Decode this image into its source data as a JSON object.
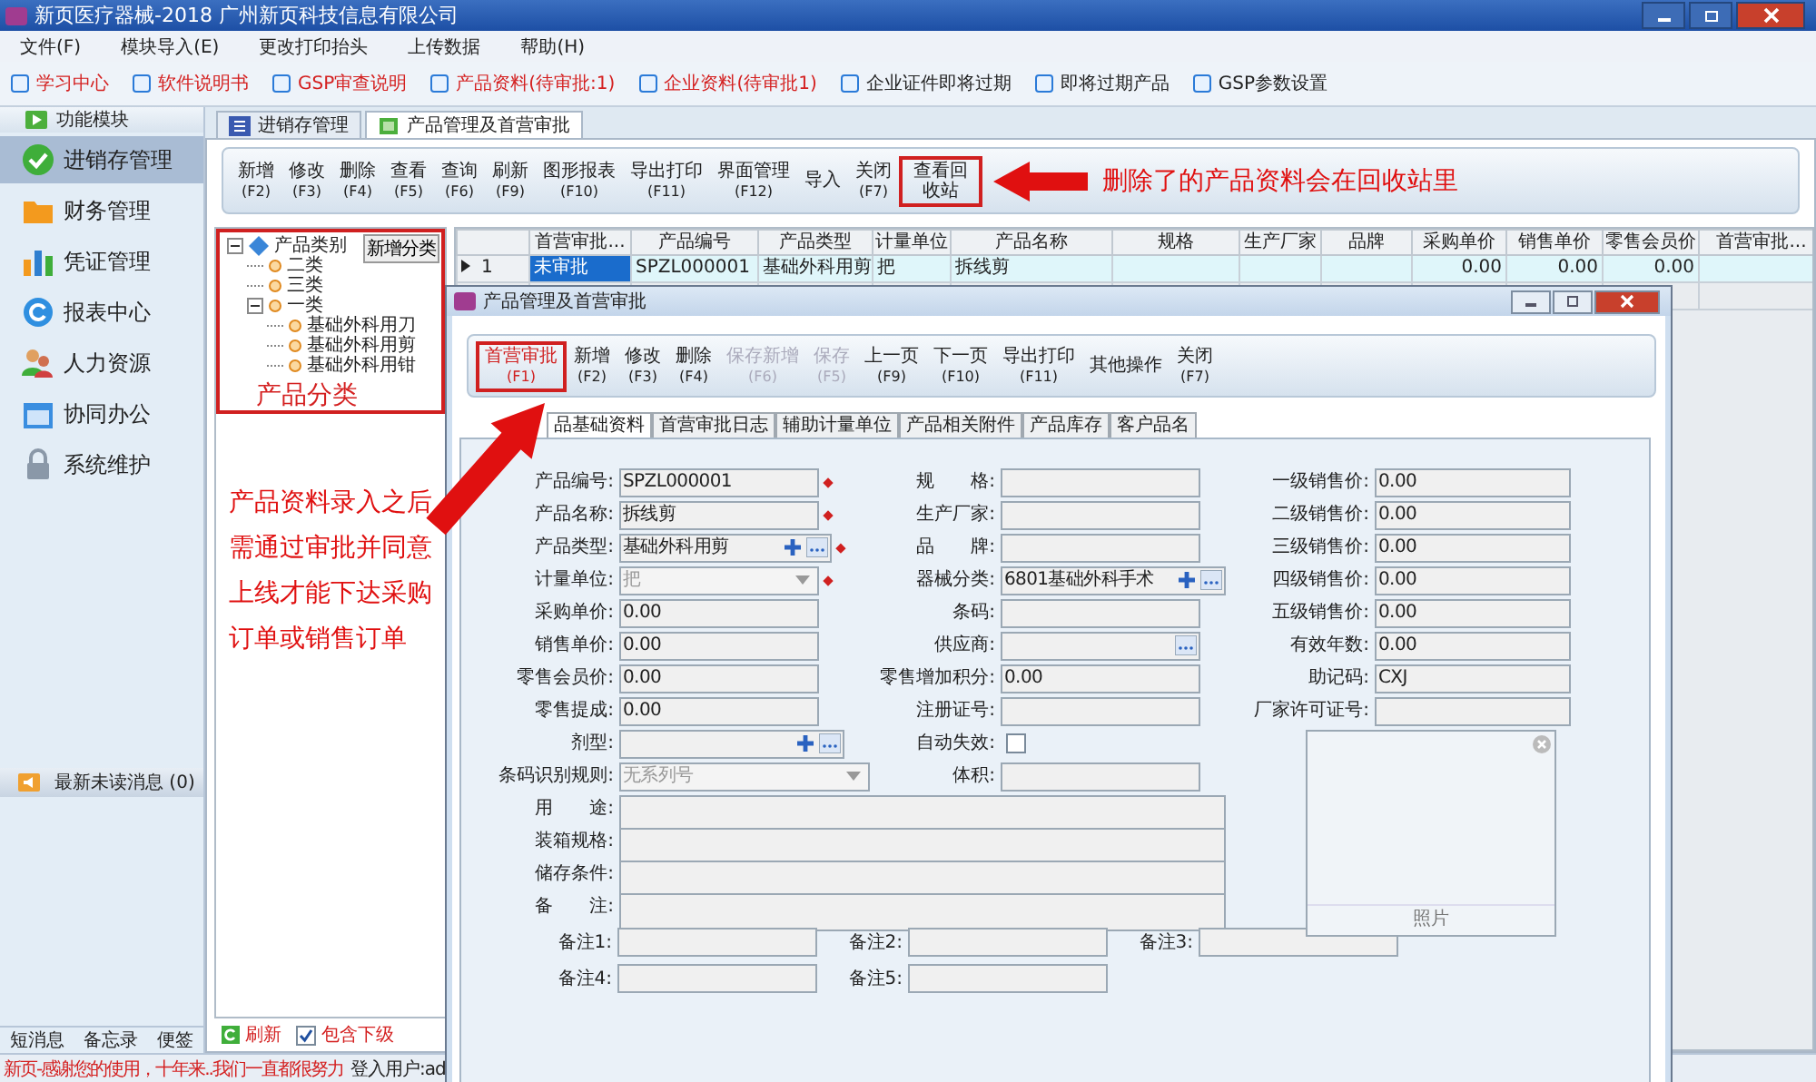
{
  "window": {
    "title": "新页医疗器械-2018 广州新页科技信息有限公司"
  },
  "menu": [
    "文件(F)",
    "模块导入(E)",
    "更改打印抬头",
    "上传数据",
    "帮助(H)"
  ],
  "quick_links": [
    {
      "label": "学习中心",
      "highlight": true
    },
    {
      "label": "软件说明书",
      "highlight": true
    },
    {
      "label": "GSP审查说明",
      "highlight": true
    },
    {
      "label": "产品资料(待审批:1)",
      "highlight": true
    },
    {
      "label": "企业资料(待审批1)",
      "highlight": true
    },
    {
      "label": "企业证件即将过期",
      "highlight": false
    },
    {
      "label": "即将过期产品",
      "highlight": false
    },
    {
      "label": "GSP参数设置",
      "highlight": false
    }
  ],
  "sidebar": {
    "header": "功能模块",
    "items": [
      {
        "label": "进销存管理",
        "kind": "check",
        "selected": true
      },
      {
        "label": "财务管理",
        "kind": "folder",
        "selected": false
      },
      {
        "label": "凭证管理",
        "kind": "bars",
        "selected": false
      },
      {
        "label": "报表中心",
        "kind": "refresh",
        "selected": false
      },
      {
        "label": "人力资源",
        "kind": "people",
        "selected": false
      },
      {
        "label": "协同办公",
        "kind": "calendar",
        "selected": false
      },
      {
        "label": "系统维护",
        "kind": "lock",
        "selected": false
      }
    ],
    "messages": "最新未读消息 (0)",
    "bottom_tabs": [
      "短消息",
      "备忘录",
      "便签"
    ]
  },
  "tabs": [
    {
      "label": "进销存管理",
      "kind": "list",
      "selected": false
    },
    {
      "label": "产品管理及首营审批",
      "kind": "book",
      "selected": true
    }
  ],
  "toolbar": [
    {
      "label": "新增",
      "key": "(F2)",
      "outlined": false
    },
    {
      "label": "修改",
      "key": "(F3)",
      "outlined": false
    },
    {
      "label": "删除",
      "key": "(F4)",
      "outlined": false
    },
    {
      "label": "查看",
      "key": "(F5)",
      "outlined": false
    },
    {
      "label": "查询",
      "key": "(F6)",
      "outlined": false
    },
    {
      "label": "刷新",
      "key": "(F9)",
      "outlined": false
    },
    {
      "label": "图形报表",
      "key": "(F10)",
      "outlined": false
    },
    {
      "label": "导出打印",
      "key": "(F11)",
      "outlined": false
    },
    {
      "label": "界面管理",
      "key": "(F12)",
      "outlined": false
    },
    {
      "label": "导入",
      "outlined": false
    },
    {
      "label": "关闭",
      "key": "(F7)",
      "outlined": false
    },
    {
      "label": "查看回收站",
      "outlined": true
    }
  ],
  "recycle_note": "删除了的产品资料会在回收站里",
  "category_tree": {
    "add_button": "新增分类",
    "note": "产品分类",
    "nodes": [
      {
        "label": "产品类别",
        "expanded": true,
        "children": [
          {
            "label": "二类"
          },
          {
            "label": "三类"
          },
          {
            "label": "一类",
            "expanded": true,
            "children": [
              {
                "label": "基础外科用刀"
              },
              {
                "label": "基础外科用剪"
              },
              {
                "label": "基础外科用钳"
              }
            ]
          }
        ]
      }
    ],
    "refresh": "刷新",
    "include_sub": {
      "label": "包含下级",
      "checked": true
    }
  },
  "approval_note": "产品资料录入之后需通过审批并同意上线才能下达采购订单或销售订单",
  "table": {
    "columns": [
      "首营审批...",
      "产品编号",
      "产品类型",
      "计量单位",
      "产品名称",
      "规格",
      "生产厂家",
      "品牌",
      "采购单价",
      "销售单价",
      "零售会员价",
      "首营审批..."
    ],
    "rows": [
      {
        "index": "1",
        "selected": true,
        "cells": [
          "未审批",
          "SPZL000001",
          "基础外科用剪",
          "把",
          "拆线剪",
          null,
          null,
          null,
          "0.00",
          "0.00",
          "0.00",
          null
        ]
      }
    ]
  },
  "status_bar": {
    "message": "新页-感谢您的使用，十年来..我们一直都很努力",
    "user": "登入用户:ad"
  },
  "dialog": {
    "title": "产品管理及首营审批",
    "toolbar": [
      {
        "label": "首营审批",
        "key": "(F1)",
        "disabled": false,
        "outlined": true
      },
      {
        "label": "新增",
        "key": "(F2)",
        "disabled": false,
        "outlined": false
      },
      {
        "label": "修改",
        "key": "(F3)",
        "disabled": false,
        "outlined": false
      },
      {
        "label": "删除",
        "key": "(F4)",
        "disabled": false,
        "outlined": false
      },
      {
        "label": "保存新增",
        "key": "(F6)",
        "disabled": true,
        "outlined": false
      },
      {
        "label": "保存",
        "key": "(F5)",
        "disabled": true,
        "outlined": false
      },
      {
        "label": "上一页",
        "key": "(F9)",
        "disabled": false,
        "outlined": false
      },
      {
        "label": "下一页",
        "key": "(F10)",
        "disabled": false,
        "outlined": false
      },
      {
        "label": "导出打印",
        "key": "(F11)",
        "disabled": false,
        "outlined": false
      },
      {
        "label": "其他操作",
        "disabled": false,
        "outlined": false
      },
      {
        "label": "关闭",
        "key": "(F7)",
        "disabled": false,
        "outlined": false
      }
    ],
    "tabs": [
      {
        "label": "品基础资料",
        "selected": true
      },
      {
        "label": "首营审批日志",
        "selected": false
      },
      {
        "label": "辅助计量单位",
        "selected": false
      },
      {
        "label": "产品相关附件",
        "selected": false
      },
      {
        "label": "产品库存",
        "selected": false
      },
      {
        "label": "客户品名",
        "selected": false
      }
    ],
    "form": {
      "rows": [
        [
          {
            "label": "产品编号:",
            "value": "SPZL000001",
            "kind": "text",
            "required": true
          },
          {
            "label": "规　　格:",
            "kind": "text",
            "required": false
          },
          {
            "label": "一级销售价:",
            "value": "0.00",
            "kind": "text",
            "required": false
          }
        ],
        [
          {
            "label": "产品名称:",
            "value": "拆线剪",
            "kind": "text",
            "required": true
          },
          {
            "label": "生产厂家:",
            "kind": "text",
            "required": false
          },
          {
            "label": "二级销售价:",
            "value": "0.00",
            "kind": "text",
            "required": false
          }
        ],
        [
          {
            "label": "产品类型:",
            "value": "基础外科用剪",
            "kind": "picker",
            "required": true
          },
          {
            "label": "品　　牌:",
            "kind": "text",
            "required": false
          },
          {
            "label": "三级销售价:",
            "value": "0.00",
            "kind": "text",
            "required": false
          }
        ],
        [
          {
            "label": "计量单位:",
            "value": "把",
            "kind": "select",
            "required": true
          },
          {
            "label": "器械分类:",
            "value": "6801基础外科手术",
            "kind": "picker",
            "required": false
          },
          {
            "label": "四级销售价:",
            "value": "0.00",
            "kind": "text",
            "required": false
          }
        ],
        [
          {
            "label": "采购单价:",
            "value": "0.00",
            "kind": "text",
            "required": false
          },
          {
            "label": "条码:",
            "kind": "text",
            "required": false
          },
          {
            "label": "五级销售价:",
            "value": "0.00",
            "kind": "text",
            "required": false
          }
        ],
        [
          {
            "label": "销售单价:",
            "value": "0.00",
            "kind": "text",
            "required": false
          },
          {
            "label": "供应商:",
            "kind": "lookup",
            "required": false
          },
          {
            "label": "有效年数:",
            "value": "0.00",
            "kind": "text",
            "required": false
          }
        ],
        [
          {
            "label": "零售会员价:",
            "value": "0.00",
            "kind": "text",
            "required": false
          },
          {
            "label": "零售增加积分:",
            "value": "0.00",
            "kind": "text",
            "required": false
          },
          {
            "label": "助记码:",
            "value": "CXJ",
            "kind": "text",
            "required": false
          }
        ],
        [
          {
            "label": "零售提成:",
            "value": "0.00",
            "kind": "text",
            "required": false
          },
          {
            "label": "注册证号:",
            "kind": "text",
            "required": false
          },
          {
            "label": "厂家许可证号:",
            "kind": "text",
            "required": false
          }
        ]
      ],
      "dosage": {
        "label": "剂型:"
      },
      "auto_expire": {
        "label": "自动失效:",
        "checked": false
      },
      "barcode_rule": {
        "label": "条码识别规则:",
        "value": "无系列号"
      },
      "volume": {
        "label": "体积:"
      },
      "notes": [
        "用　　途:",
        "装箱规格:",
        "储存条件:",
        "备　　注:"
      ],
      "photo": {
        "label": "照片"
      },
      "remarks": [
        [
          "备注1:",
          "备注2:",
          "备注3:"
        ],
        [
          "备注4:",
          "备注5:"
        ]
      ]
    }
  }
}
